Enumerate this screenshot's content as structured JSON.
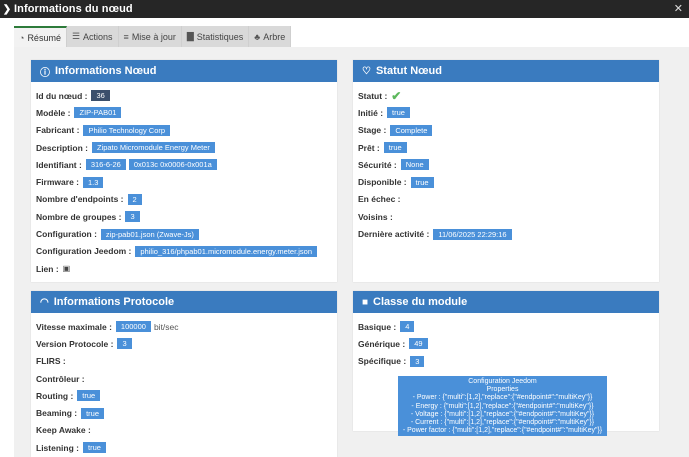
{
  "window": {
    "title": "Informations du nœud",
    "close": "✕"
  },
  "tabs": [
    {
      "label": "Résumé",
      "icon": "dashboard-icon"
    },
    {
      "label": "Actions",
      "icon": "list-icon"
    },
    {
      "label": "Mise à jour",
      "icon": "server-icon"
    },
    {
      "label": "Statistiques",
      "icon": "bar-chart-icon"
    },
    {
      "label": "Arbre",
      "icon": "tree-icon"
    }
  ],
  "node_info": {
    "title": "Informations Nœud",
    "id_label": "Id du nœud :",
    "id_value": "36",
    "model_label": "Modèle :",
    "model_value": "ZIP-PAB01",
    "manufacturer_label": "Fabricant :",
    "manufacturer_value": "Philio Technology Corp",
    "description_label": "Description :",
    "description_value": "Zipato Micromodule Energy Meter",
    "identifier_label": "Identifiant :",
    "identifier_value_1": "316-6-26",
    "identifier_value_2": "0x013c 0x0006-0x001a",
    "firmware_label": "Firmware :",
    "firmware_value": "1.3",
    "endpoints_label": "Nombre d'endpoints :",
    "endpoints_value": "2",
    "groups_label": "Nombre de groupes :",
    "groups_value": "3",
    "config_label": "Configuration :",
    "config_value": "zip-pab01.json (Zwave-Js)",
    "jeedom_config_label": "Configuration Jeedom :",
    "jeedom_config_value": "philio_316/phpab01.micromodule.energy.meter.json",
    "link_label": "Lien :"
  },
  "node_status": {
    "title": "Statut Nœud",
    "status_label": "Statut :",
    "initiated_label": "Initié :",
    "initiated_value": "true",
    "stage_label": "Stage :",
    "stage_value": "Complete",
    "ready_label": "Prêt :",
    "ready_value": "true",
    "security_label": "Sécurité :",
    "security_value": "None",
    "available_label": "Disponible :",
    "available_value": "true",
    "failed_label": "En échec :",
    "neighbors_label": "Voisins :",
    "last_activity_label": "Dernière activité :",
    "last_activity_value": "11/06/2025 22:29:16"
  },
  "protocol_info": {
    "title": "Informations Protocole",
    "speed_label": "Vitesse maximale :",
    "speed_value": "100000",
    "speed_unit": "bit/sec",
    "version_label": "Version Protocole :",
    "version_value": "3",
    "flirs_label": "FLIRS :",
    "controller_label": "Contrôleur :",
    "routing_label": "Routing :",
    "routing_value": "true",
    "beaming_label": "Beaming :",
    "beaming_value": "true",
    "keep_awake_label": "Keep Awake :",
    "listening_label": "Listening :",
    "listening_value": "true"
  },
  "module_class": {
    "title": "Classe du module",
    "basic_label": "Basique :",
    "basic_value": "4",
    "generic_label": "Générique :",
    "generic_value": "49",
    "specific_label": "Spécifique :",
    "specific_value": "3",
    "jeedom_config_title": "Configuration Jeedom",
    "properties_title": "Properties",
    "properties": [
      "- Power : {\"multi\":[1,2],\"replace\":{\"#endpoint#\":\"multiKey\"}}",
      "- Energy : {\"multi\":[1,2],\"replace\":{\"#endpoint#\":\"multiKey\"}}",
      "- Voltage : {\"multi\":[1,2],\"replace\":{\"#endpoint#\":\"multiKey\"}}",
      "- Current : {\"multi\":[1,2],\"replace\":{\"#endpoint#\":\"multiKey\"}}",
      "- Power factor : {\"multi\":[1,2],\"replace\":{\"#endpoint#\":\"multiKey\"}}"
    ]
  },
  "colors": {
    "header": "#3a7bbf",
    "badge": "#4a90d9",
    "titlebar": "#262626",
    "check": "#5cb85c"
  }
}
